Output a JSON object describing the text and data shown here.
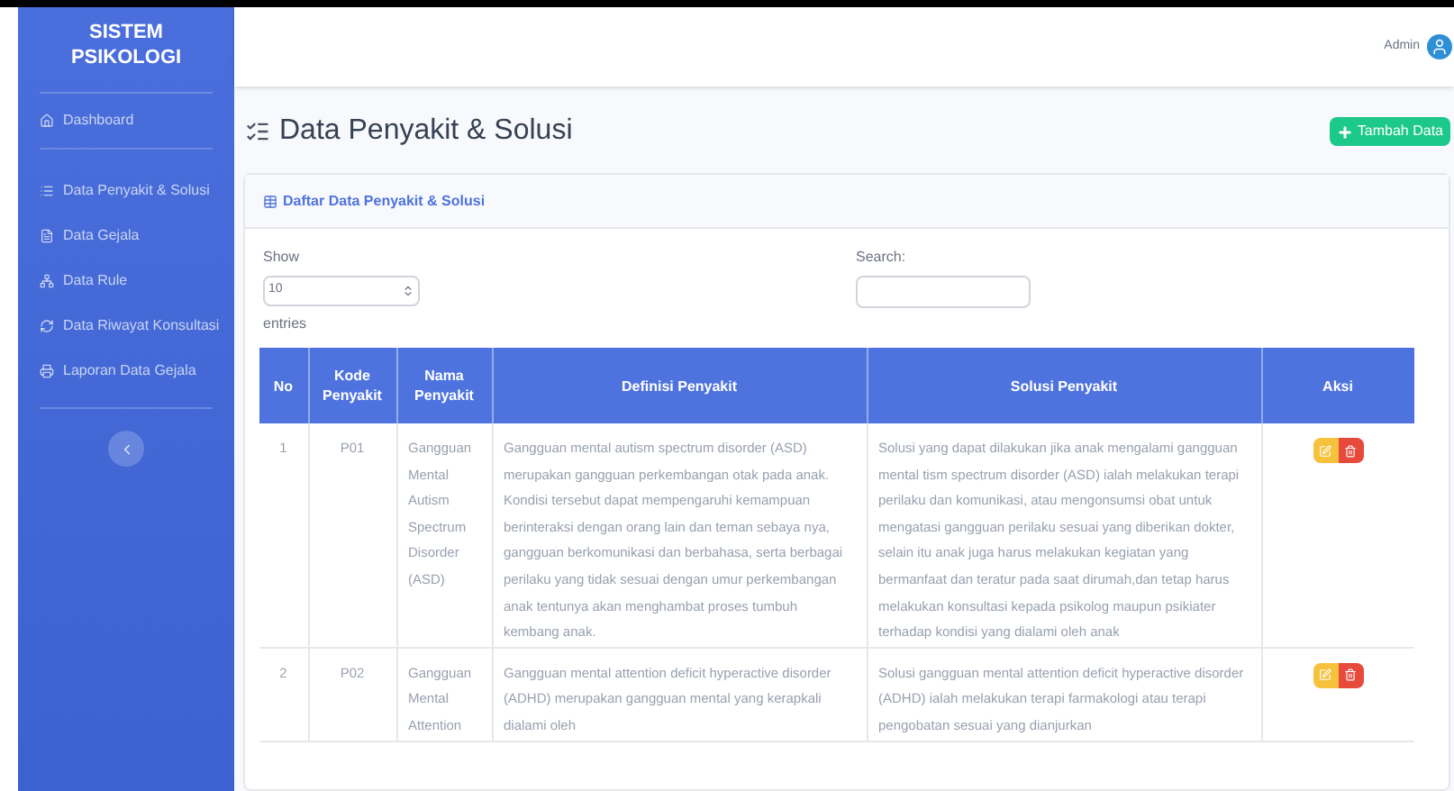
{
  "sidebar": {
    "brand": "SISTEM PSIKOLOGI",
    "items": [
      {
        "kind": "home",
        "label": "Dashboard"
      },
      {
        "kind": "list",
        "label": "Data Penyakit & Solusi"
      },
      {
        "kind": "file",
        "label": "Data Gejala"
      },
      {
        "kind": "network",
        "label": "Data Rule"
      },
      {
        "kind": "history",
        "label": "Data Riwayat Konsultasi"
      },
      {
        "kind": "print",
        "label": "Laporan Data Gejala"
      }
    ]
  },
  "topbar": {
    "user": "Admin"
  },
  "page": {
    "title": "Data Penyakit & Solusi",
    "add_button": "Tambah Data"
  },
  "card": {
    "title": "Daftar Data Penyakit & Solusi",
    "length": {
      "label_before": "Show",
      "value": "10",
      "label_after": "entries"
    },
    "search": {
      "label": "Search:"
    },
    "table": {
      "columns": [
        "No",
        "Kode Penyakit",
        "Nama Penyakit",
        "Definisi Penyakit",
        "Solusi Penyakit",
        "Aksi"
      ],
      "rows": [
        {
          "no": "1",
          "kode": "P01",
          "nama": "Gangguan Mental Autism Spectrum Disorder (ASD)",
          "definisi": "Gangguan mental autism spectrum disorder (ASD) merupakan gangguan perkembangan otak pada anak. Kondisi tersebut dapat mempengaruhi kemampuan berinteraksi dengan orang lain dan teman sebaya nya, gangguan berkomunikasi dan berbahasa, serta berbagai perilaku yang tidak sesuai dengan umur perkembangan anak tentunya akan menghambat proses tumbuh kembang anak.",
          "solusi": "Solusi yang dapat dilakukan jika anak mengalami gangguan mental tism spectrum disorder (ASD) ialah melakukan terapi perilaku dan komunikasi, atau mengonsumsi obat untuk mengatasi gangguan perilaku sesuai yang diberikan dokter, selain itu anak juga harus melakukan kegiatan yang bermanfaat dan teratur pada saat dirumah,dan tetap harus melakukan konsultasi kepada psikolog maupun psikiater terhadap kondisi yang dialami oleh anak"
        },
        {
          "no": "2",
          "kode": "P02",
          "nama": "Gangguan Mental Attention",
          "definisi": "Gangguan mental attention deficit hyperactive disorder (ADHD) merupakan gangguan mental yang kerapkali dialami oleh",
          "solusi": "Solusi gangguan mental attention deficit hyperactive disorder (ADHD) ialah melakukan terapi farmakologi atau terapi pengobatan sesuai yang dianjurkan"
        }
      ]
    }
  }
}
